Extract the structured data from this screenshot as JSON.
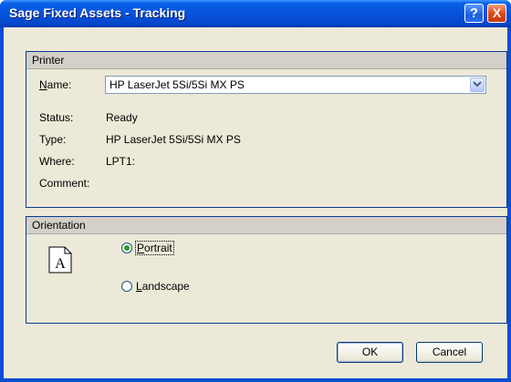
{
  "window": {
    "title": "Sage Fixed Assets - Tracking",
    "help_glyph": "?",
    "close_glyph": "X"
  },
  "printer": {
    "group_label": "Printer",
    "name_label_accel": "N",
    "name_label_rest": "ame:",
    "name_value": "HP LaserJet 5Si/5Si MX PS",
    "status_label": "Status:",
    "status_value": "Ready",
    "type_label": "Type:",
    "type_value": "HP LaserJet 5Si/5Si MX PS",
    "where_label": "Where:",
    "where_value": "LPT1:",
    "comment_label": "Comment:",
    "comment_value": ""
  },
  "orientation": {
    "group_label": "Orientation",
    "page_glyph": "A",
    "portrait_accel": "P",
    "portrait_rest": "ortrait",
    "portrait_checked": true,
    "landscape_accel": "L",
    "landscape_rest": "andscape",
    "landscape_checked": false
  },
  "buttons": {
    "ok_label": "OK",
    "cancel_label": "Cancel"
  },
  "icons": {
    "help": "help-icon",
    "close": "close-icon",
    "dropdown": "chevron-down-icon",
    "page": "page-portrait-icon"
  }
}
